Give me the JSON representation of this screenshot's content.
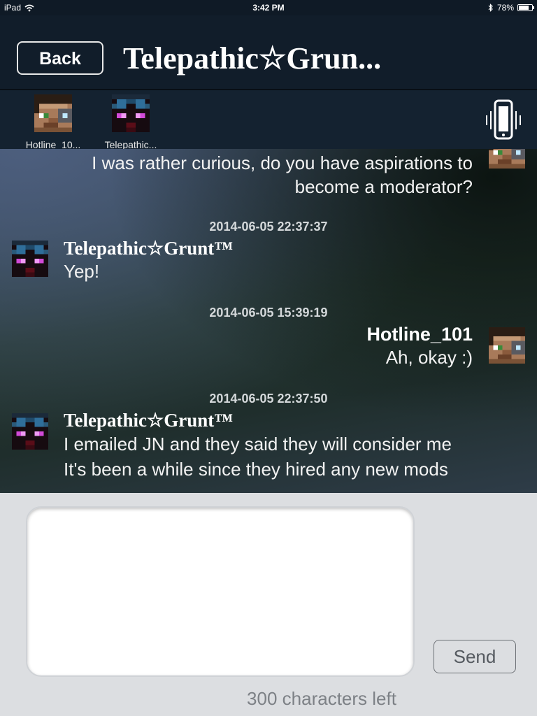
{
  "status_bar": {
    "device": "iPad",
    "time": "3:42 PM",
    "battery": "78%",
    "battery_level": 0.78,
    "wifi_icon": "wifi-icon",
    "bluetooth_icon": "bluetooth-icon"
  },
  "nav": {
    "back_label": "Back",
    "title": "Telepathic☆Grun..."
  },
  "participants": [
    {
      "name": "Hotline_10...",
      "avatar": "hotline-avatar"
    },
    {
      "name": "Telepathic...",
      "avatar": "telepathic-avatar"
    }
  ],
  "vibrate_icon": "phone-vibrate-icon",
  "messages": [
    {
      "side": "right",
      "sender": "",
      "lines": [
        "I was rather curious, do you have aspirations to",
        "become a moderator?"
      ]
    },
    {
      "timestamp": "2014-06-05 22:37:37",
      "side": "left",
      "sender": "Telepathic☆Grunt™",
      "lines": [
        "Yep!"
      ]
    },
    {
      "timestamp": "2014-06-05 15:39:19",
      "side": "right",
      "sender": "Hotline_101",
      "lines": [
        "Ah, okay :)"
      ]
    },
    {
      "timestamp": "2014-06-05 22:37:50",
      "side": "left",
      "sender": "Telepathic☆Grunt™",
      "lines": [
        "I emailed JN and they said they will consider me",
        "It's been a while since they hired any new mods"
      ]
    }
  ],
  "compose": {
    "input_value": "",
    "send_label": "Send",
    "chars_left": "300 characters left"
  },
  "colors": {
    "header_bg": "#111d2a",
    "compose_bg": "#dcdee1"
  }
}
